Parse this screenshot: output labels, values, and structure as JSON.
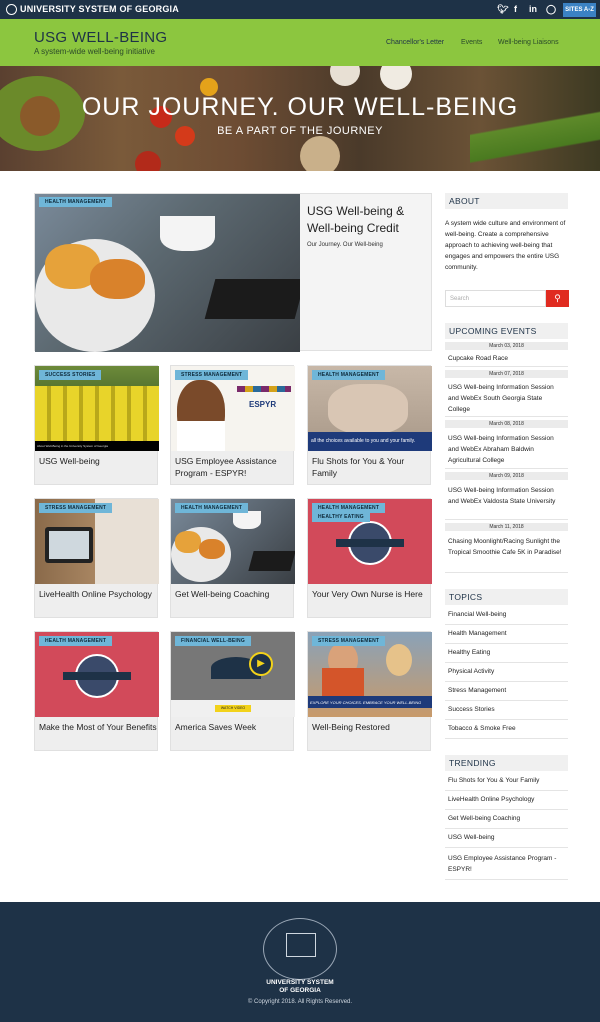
{
  "topbar": {
    "org_name": "UNIVERSITY SYSTEM OF GEORGIA",
    "social_icons": [
      "twitter-icon",
      "facebook-icon",
      "linkedin-icon",
      "instagram-icon"
    ],
    "sites_label": "SITES A-Z"
  },
  "header": {
    "title": "USG WELL-BEING",
    "tagline": "A system-wide well-being initiative",
    "nav": [
      "Chancellor's Letter",
      "Events",
      "Well-being Liaisons"
    ]
  },
  "hero": {
    "headline": "OUR JOURNEY. OUR WELL-BEING",
    "subheadline": "BE A PART OF THE JOURNEY"
  },
  "featured": {
    "badge": "HEALTH MANAGEMENT",
    "title": "USG Well-being & Well-being Credit",
    "subtitle": "Our Journey. Our Well-being"
  },
  "cards": [
    {
      "badge": "SUCCESS STORIES",
      "badge2": "",
      "title": "USG Well-being",
      "overlay": "About Well-Being in the University System of Georgia"
    },
    {
      "badge": "STRESS MANAGEMENT",
      "badge2": "",
      "title": "USG Employee Assistance Program - ESPYR!",
      "overlay": "ESPYR"
    },
    {
      "badge": "HEALTH MANAGEMENT",
      "badge2": "",
      "title": "Flu Shots for You & Your Family",
      "overlay": "all the choices available to you and your family."
    },
    {
      "badge": "STRESS MANAGEMENT",
      "badge2": "",
      "title": "LiveHealth Online Psychology",
      "overlay": ""
    },
    {
      "badge": "HEALTH MANAGEMENT",
      "badge2": "",
      "title": "Get Well-being Coaching",
      "overlay": ""
    },
    {
      "badge": "HEALTH MANAGEMENT",
      "badge2": "HEALTHY EATING",
      "title": "Your Very Own Nurse is Here",
      "overlay": ""
    },
    {
      "badge": "HEALTH MANAGEMENT",
      "badge2": "",
      "title": "Make the Most of Your Benefits",
      "overlay": ""
    },
    {
      "badge": "FINANCIAL WELL-BEING",
      "badge2": "",
      "title": "America Saves Week",
      "overlay": "WATCH VIDEO"
    },
    {
      "badge": "STRESS MANAGEMENT",
      "badge2": "",
      "title": "Well-Being Restored",
      "overlay": "EXPLORE YOUR CHOICES. EMBRACE YOUR WELL-BEING"
    }
  ],
  "sidebar": {
    "about_heading": "ABOUT",
    "about_text": "A system wide culture and environment of well-being. Create a comprehensive approach to achieving well-being that engages and empowers the entire USG community.",
    "search_placeholder": "Search",
    "events_heading": "UPCOMING EVENTS",
    "events": [
      {
        "date": "March 03, 2018",
        "title": "Cupcake Road Race"
      },
      {
        "date": "March 07, 2018",
        "title": "USG Well-being Information Session and WebEx South Georgia State College"
      },
      {
        "date": "March 08, 2018",
        "title": "USG Well-being Information Session and WebEx Abraham Baldwin Agricultural College"
      },
      {
        "date": "March 09, 2018",
        "title": "USG Well-being Information Session and WebEx Valdosta State University"
      },
      {
        "date": "March 11, 2018",
        "title": "Chasing Moonlight/Racing Sunlight the Tropical Smoothie Cafe 5K in Paradise!"
      }
    ],
    "topics_heading": "TOPICS",
    "topics": [
      "Financial Well-being",
      "Health Management",
      "Healthy Eating",
      "Physical Activity",
      "Stress Management",
      "Success Stories",
      "Tobacco & Smoke Free"
    ],
    "trending_heading": "TRENDING",
    "trending": [
      "Flu Shots for You & Your Family",
      "LiveHealth Online Psychology",
      "Get Well-being Coaching",
      "USG Well-being",
      "USG Employee Assistance Program - ESPYR!"
    ]
  },
  "footer": {
    "org_line1": "UNIVERSITY SYSTEM",
    "org_line2": "OF GEORGIA",
    "copyright": "© Copyright 2018. All Rights Reserved."
  }
}
